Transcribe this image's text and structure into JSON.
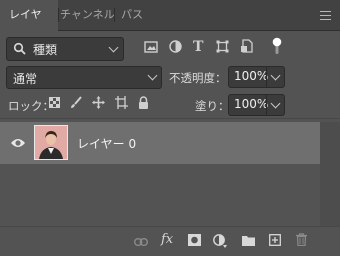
{
  "tabs": [
    {
      "label": "レイヤー",
      "active": true
    },
    {
      "label": "チャンネル",
      "active": false
    },
    {
      "label": "パス",
      "active": false
    }
  ],
  "filter": {
    "selected": "種類",
    "icons": [
      "image-filter-icon",
      "adjustment-filter-icon",
      "type-filter-icon",
      "shape-filter-icon",
      "smart-object-filter-icon",
      "filter-toggle-icon"
    ]
  },
  "blend": {
    "mode": "通常",
    "opacity_label": "不透明度：",
    "opacity_value": "100%"
  },
  "lock": {
    "label": "ロック：",
    "icons": [
      "lock-transparent-pixels-icon",
      "lock-image-pixels-icon",
      "lock-position-icon",
      "lock-artboard-icon",
      "lock-all-icon"
    ],
    "fill_label": "塗り：",
    "fill_value": "100%"
  },
  "layers": [
    {
      "name": "レイヤー 0",
      "visible": true,
      "selected": true
    }
  ],
  "footer_icons": [
    "link-layers-icon",
    "layer-style-icon",
    "add-mask-icon",
    "adjustment-layer-icon",
    "new-group-icon",
    "new-layer-icon",
    "delete-layer-icon"
  ],
  "colors": {
    "panel": "#535353",
    "tabbar": "#424242",
    "selected_row": "#6f6f6f",
    "field": "#3b3b3b"
  }
}
